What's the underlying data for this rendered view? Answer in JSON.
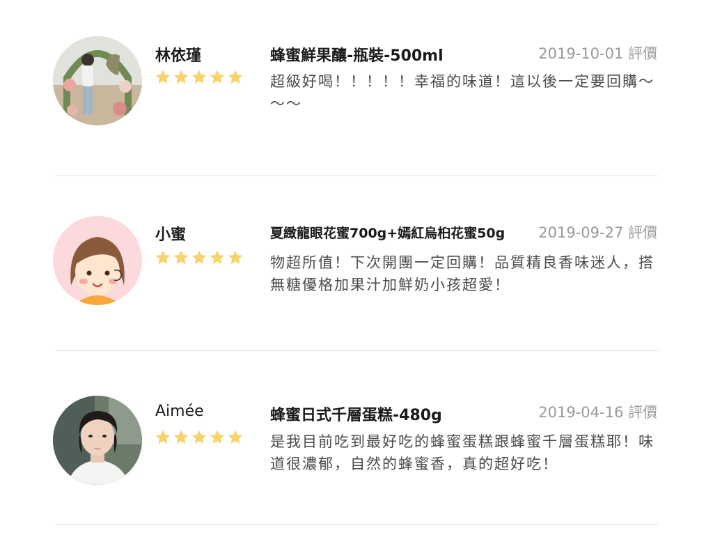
{
  "reviews": [
    {
      "name": "林依瑾",
      "rating": 5,
      "product": "蜂蜜鮮果釀-瓶裝-500ml",
      "date": "2019-10-01 評價",
      "comment": "超級好喝！！！！！幸福的味道！這以後一定要回購～～～",
      "avatar": "photo-woman-flower-arch"
    },
    {
      "name": "小蜜",
      "rating": 5,
      "product": "夏緻龍眼花蜜700g+嫣紅烏桕花蜜50g",
      "date": "2019-09-27 評價",
      "comment": "物超所值！下次開團一定回購！品質精良香味迷人，搭無糖優格加果汁加鮮奶小孩超愛！",
      "avatar": "cartoon-girl"
    },
    {
      "name": "Aimée",
      "rating": 5,
      "product": "蜂蜜日式千層蛋糕-480g",
      "date": "2019-04-16 評價",
      "comment": "是我目前吃到最好吃的蜂蜜蛋糕跟蜂蜜千層蛋糕耶！味道很濃郁，自然的蜂蜜香，真的超好吃！",
      "avatar": "photo-woman-portrait"
    }
  ],
  "colors": {
    "star": "#f7d36b",
    "date": "#9a9a9a",
    "divider": "#dedede"
  }
}
